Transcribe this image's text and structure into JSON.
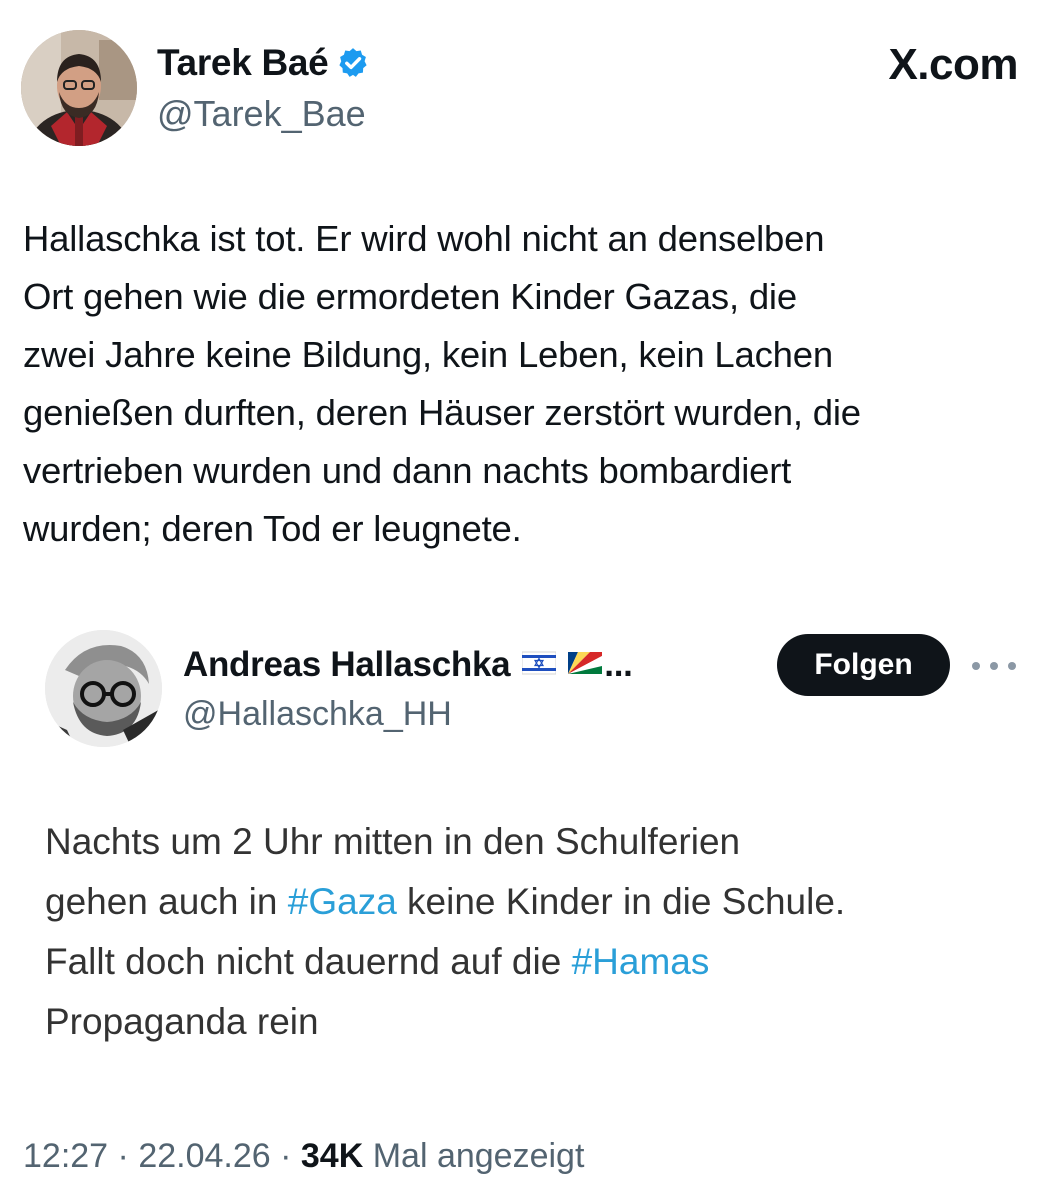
{
  "header": {
    "author_name": "Tarek Baé",
    "author_handle": "@Tarek_Bae",
    "site_label": "X.com",
    "verified_icon": "verified-badge-icon",
    "accent_color": "#1d9bf0"
  },
  "tweet": {
    "lines": [
      "Hallaschka ist tot. Er wird wohl nicht an denselben",
      "Ort gehen wie die ermordeten Kinder Gazas, die",
      "zwei Jahre keine Bildung, kein Leben, kein Lachen",
      "genießen durften, deren Häuser zerstört wurden, die",
      "vertrieben wurden und dann nachts bombardiert",
      "wurden; deren Tod er leugnete."
    ]
  },
  "quote": {
    "author_name": "Andreas Hallaschka",
    "name_ellipsis": "...",
    "author_handle": "@Hallaschka_HH",
    "follow_label": "Folgen",
    "more_icon": "more-horizontal-icon",
    "flags": [
      "israel-flag-icon",
      "seychelles-flag-icon"
    ],
    "line1": "Nachts um 2 Uhr mitten in den Schulferien",
    "line2_before": "gehen auch in ",
    "line2_hashtag": "#Gaza",
    "line2_after": " keine Kinder in die Schule.",
    "line3_before": "Fallt doch nicht dauernd auf die ",
    "line3_hashtag": "#Hamas",
    "line4": "Propaganda rein",
    "hashtag_color": "#2a9fd8"
  },
  "footer": {
    "time": "12:27",
    "separator": " · ",
    "date": "22.04.26",
    "views_count": "34K",
    "views_label": " Mal angezeigt"
  }
}
